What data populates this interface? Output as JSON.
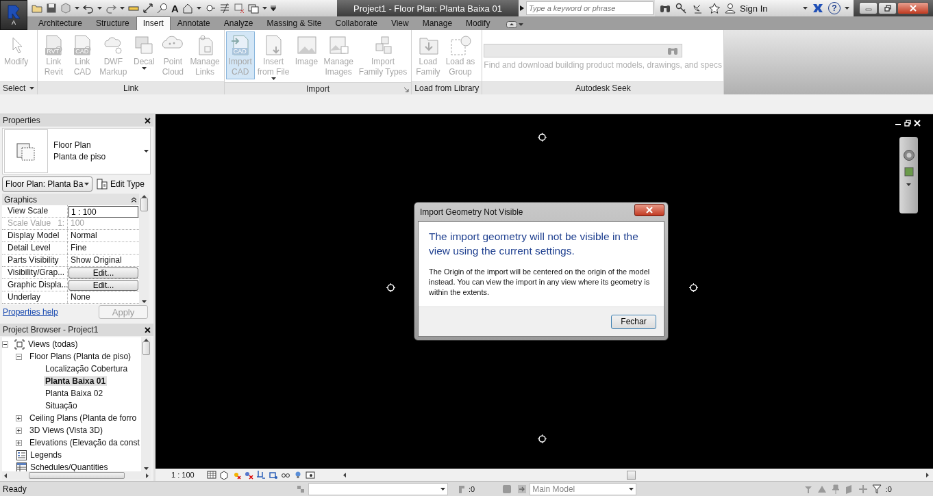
{
  "app_button": {
    "label": "A"
  },
  "quick_access": {
    "text_tool": "A"
  },
  "title_bar": {
    "title": "Project1 - Floor Plan: Planta Baixa 01",
    "search": {
      "placeholder": "Type a keyword or phrase"
    },
    "sign_in": "Sign In",
    "help": "?"
  },
  "tabs": [
    {
      "label": "Architecture",
      "selected": false
    },
    {
      "label": "Structure",
      "selected": false
    },
    {
      "label": "Insert",
      "selected": true
    },
    {
      "label": "Annotate",
      "selected": false
    },
    {
      "label": "Analyze",
      "selected": false
    },
    {
      "label": "Massing & Site",
      "selected": false
    },
    {
      "label": "Collaborate",
      "selected": false
    },
    {
      "label": "View",
      "selected": false
    },
    {
      "label": "Manage",
      "selected": false
    },
    {
      "label": "Modify",
      "selected": false
    }
  ],
  "ribbon": {
    "panels": [
      {
        "title": "Select",
        "dropdown": true,
        "buttons": [
          {
            "label": "Modify",
            "disabled": true,
            "highlighted": false
          }
        ]
      },
      {
        "title": "Link",
        "buttons": [
          {
            "label": "Link\nRevit",
            "badge": "RVT",
            "disabled": true,
            "highlighted": false
          },
          {
            "label": "Link\nCAD",
            "badge": "CAD",
            "disabled": true,
            "highlighted": false
          },
          {
            "label": "DWF\nMarkup",
            "disabled": true,
            "highlighted": false
          },
          {
            "label": "Decal",
            "has_menu": true,
            "disabled": true,
            "highlighted": false
          },
          {
            "label": "Point\nCloud",
            "disabled": true,
            "highlighted": false
          },
          {
            "label": "Manage\nLinks",
            "disabled": true,
            "highlighted": false
          }
        ]
      },
      {
        "title": "Import",
        "launcher": true,
        "buttons": [
          {
            "label": "Import\nCAD",
            "badge": "CAD",
            "disabled": true,
            "highlighted": true
          },
          {
            "label": "Insert\nfrom File",
            "has_menu": true,
            "disabled": true,
            "highlighted": false
          },
          {
            "label": "Image",
            "disabled": true,
            "highlighted": false
          },
          {
            "label": "Manage\nImages",
            "disabled": true,
            "highlighted": false
          },
          {
            "label": "Import\nFamily Types",
            "disabled": true,
            "highlighted": false
          }
        ]
      },
      {
        "title": "Load from Library",
        "buttons": [
          {
            "label": "Load\nFamily",
            "disabled": true,
            "highlighted": false
          },
          {
            "label": "Load as\nGroup",
            "disabled": true,
            "highlighted": false
          }
        ]
      }
    ],
    "seek": {
      "title": "Autodesk Seek",
      "hint": "Find and download building product models, drawings, and specs"
    }
  },
  "properties": {
    "title": "Properties",
    "type_name": "Floor Plan",
    "type_sub": "Planta de piso",
    "instance_selector": "Floor Plan: Planta Ba",
    "edit_type": "Edit Type",
    "group": "Graphics",
    "rows": [
      {
        "name": "View Scale",
        "value": "1 : 100",
        "kind": "input",
        "disabled": false
      },
      {
        "name": "Scale Value",
        "suffix": "1:",
        "value": "100",
        "kind": "text",
        "disabled": true
      },
      {
        "name": "Display Model",
        "value": "Normal",
        "kind": "text",
        "disabled": false
      },
      {
        "name": "Detail Level",
        "value": "Fine",
        "kind": "text",
        "disabled": false
      },
      {
        "name": "Parts Visibility",
        "value": "Show Original",
        "kind": "text",
        "disabled": false
      },
      {
        "name": "Visibility/Grap...",
        "value": "Edit...",
        "kind": "button",
        "disabled": false
      },
      {
        "name": "Graphic Displa...",
        "value": "Edit...",
        "kind": "button",
        "disabled": false
      },
      {
        "name": "Underlay",
        "value": "None",
        "kind": "text",
        "disabled": false
      }
    ],
    "help": "Properties help",
    "apply": "Apply"
  },
  "browser": {
    "title": "Project Browser - Project1",
    "tree": [
      {
        "label": "Views (todas)",
        "expanded": true,
        "selected": false,
        "children": [
          {
            "label": "Floor Plans (Planta de piso)",
            "expanded": true,
            "selected": false,
            "children": [
              {
                "label": "Localização Cobertura",
                "selected": false
              },
              {
                "label": "Planta Baixa 01",
                "selected": true
              },
              {
                "label": "Planta Baixa 02",
                "selected": false
              },
              {
                "label": "Situação",
                "selected": false
              }
            ]
          },
          {
            "label": "Ceiling Plans (Planta de forro",
            "expanded": false,
            "selected": false
          },
          {
            "label": "3D Views (Vista 3D)",
            "expanded": false,
            "selected": false
          },
          {
            "label": "Elevations (Elevação da const",
            "expanded": false,
            "selected": false
          }
        ]
      },
      {
        "label": "Legends",
        "selected": false
      },
      {
        "label": "Schedules/Quantities",
        "selected": false
      }
    ]
  },
  "dialog": {
    "title": "Import Geometry Not Visible",
    "heading": "The import geometry will not be visible in the view using the current settings.",
    "body": "The Origin of the import will be centered on the origin of the model instead. You can view the import in any view where its geometry is within the extents.",
    "button": "Fechar"
  },
  "view_bar": {
    "scale": "1 : 100"
  },
  "status_bar": {
    "text": "Ready",
    "selection_count": ":0",
    "workset": "Main Model",
    "filter_count": ":0"
  }
}
